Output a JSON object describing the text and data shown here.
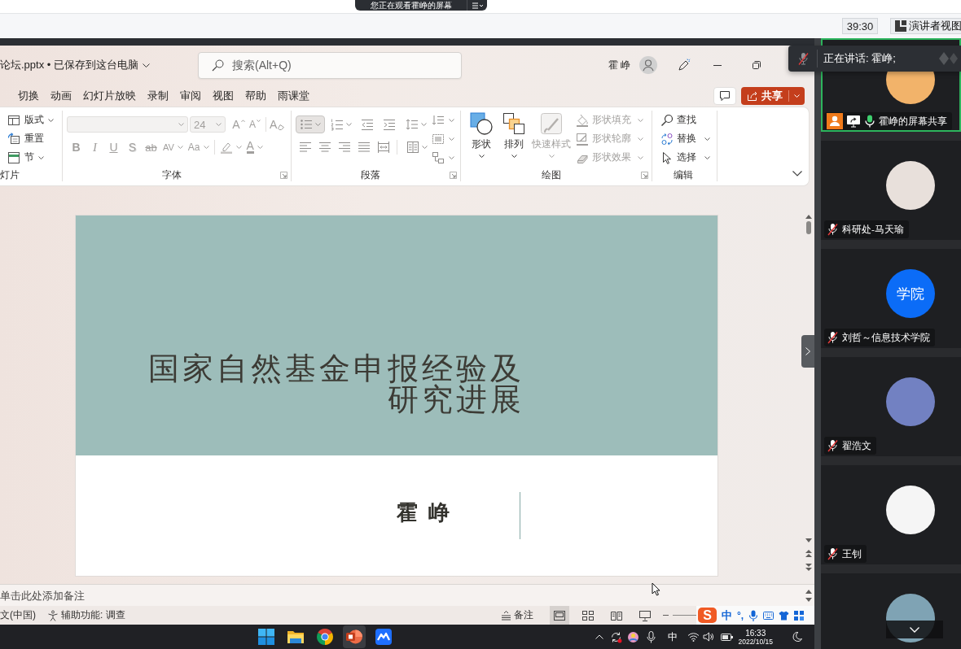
{
  "share_banner": {
    "text": "您正在观看霍峥的屏幕"
  },
  "meeting_toolbar": {
    "timer": "39:30",
    "presenter_view": "演讲者视图"
  },
  "window": {
    "title": "论坛.pptx • 已保存到这台电脑",
    "search": {
      "placeholder": "搜索(Alt+Q)"
    },
    "user": "霍 峥"
  },
  "menu_tabs": [
    "切换",
    "动画",
    "幻灯片放映",
    "录制",
    "审阅",
    "视图",
    "帮助",
    "雨课堂"
  ],
  "share_button": {
    "label": "共享"
  },
  "ribbon": {
    "slides": {
      "label": "灯片",
      "items": [
        {
          "kind": "layout",
          "label": "版式",
          "has_menu": true
        },
        {
          "kind": "reset",
          "label": "重置",
          "has_menu": false
        },
        {
          "kind": "section",
          "label": "节",
          "has_menu": true
        }
      ]
    },
    "font": {
      "label": "字体",
      "disabled": true,
      "size": "24",
      "size_tools": [
        {
          "kind": "grow",
          "label": "A"
        },
        {
          "kind": "shrink",
          "label": "A"
        },
        {
          "kind": "clear",
          "label": "A"
        }
      ],
      "formats": [
        {
          "kind": "bold",
          "label": "B",
          "has_menu": false
        },
        {
          "kind": "italic",
          "label": "I",
          "has_menu": false
        },
        {
          "kind": "underline",
          "label": "U",
          "has_menu": false
        },
        {
          "kind": "shadow",
          "label": "S",
          "has_menu": false
        },
        {
          "kind": "strike",
          "label": "ab",
          "has_menu": false
        },
        {
          "kind": "spacing",
          "label": "AV",
          "has_menu": true
        },
        {
          "kind": "case",
          "label": "Aa",
          "has_menu": true
        },
        {
          "kind": "highlight",
          "has_menu": true
        },
        {
          "kind": "color",
          "label": "A",
          "has_menu": true
        }
      ]
    },
    "paragraph": {
      "label": "段落",
      "disabled": true,
      "bullets": {
        "on": true
      }
    },
    "drawing": {
      "label": "绘图",
      "large": [
        {
          "kind": "shapes",
          "label": "形状",
          "disabled": false
        },
        {
          "kind": "arrange",
          "label": "排列",
          "disabled": false
        },
        {
          "kind": "quick_styles",
          "label": "快速样式",
          "disabled": true
        }
      ],
      "small": [
        {
          "kind": "fill",
          "label": "形状填充",
          "disabled": true
        },
        {
          "kind": "outline",
          "label": "形状轮廓",
          "disabled": true
        },
        {
          "kind": "effects",
          "label": "形状效果",
          "disabled": true
        }
      ]
    },
    "editing": {
      "label": "编辑",
      "items": [
        {
          "kind": "find",
          "label": "查找",
          "has_menu": false
        },
        {
          "kind": "replace",
          "label": "替换",
          "has_menu": true
        },
        {
          "kind": "select",
          "label": "选择",
          "has_menu": true
        }
      ]
    }
  },
  "slide": {
    "title": "国家自然基金申报经验及研究进展",
    "author": "霍 峥"
  },
  "notes": {
    "placeholder": "单击此处添加备注"
  },
  "status_bar": {
    "language": "文(中国)",
    "accessibility": "辅助功能: 调查",
    "notes_button": "备注",
    "views": [
      {
        "kind": "normal",
        "selected": true
      },
      {
        "kind": "sorter",
        "selected": false
      },
      {
        "kind": "reading",
        "selected": false
      },
      {
        "kind": "slideshow",
        "selected": false
      }
    ]
  },
  "ime_bar": {
    "logo": "S",
    "mode": "中",
    "punctuation": "°,"
  },
  "taskbar": {
    "apps": [
      {
        "kind": "start",
        "selected": false
      },
      {
        "kind": "file_explorer",
        "selected": false
      },
      {
        "kind": "browser",
        "selected": false
      },
      {
        "kind": "presentation",
        "selected": true
      },
      {
        "kind": "meeting",
        "selected": false
      }
    ],
    "input_mode": "中",
    "time": "16:33",
    "date": "2022/10/15"
  },
  "speaking_toast": {
    "text": "正在讲话: 霍峥;",
    "muted": true
  },
  "participants": [
    {
      "name": "霍峥的屏幕共享",
      "kind": "photo",
      "color": "#f2b36a",
      "speaking": true,
      "sharing": true,
      "muted": false
    },
    {
      "name": "科研处-马天瑜",
      "kind": "photo",
      "color": "#e8e0db",
      "speaking": false,
      "sharing": false,
      "muted": true
    },
    {
      "name": "刘哲～信息技术学院",
      "kind": "initials",
      "avatar_text": "学院",
      "color": "#0b6cf7",
      "speaking": false,
      "sharing": false,
      "muted": true
    },
    {
      "name": "翟浩文",
      "kind": "photo",
      "color": "#7281c2",
      "speaking": false,
      "sharing": false,
      "muted": true
    },
    {
      "name": "王钊",
      "kind": "photo",
      "color": "#f5f5f5",
      "speaking": false,
      "sharing": false,
      "muted": true
    },
    {
      "kind": "photo",
      "color": "#7fa3b4",
      "speaking": false
    }
  ]
}
